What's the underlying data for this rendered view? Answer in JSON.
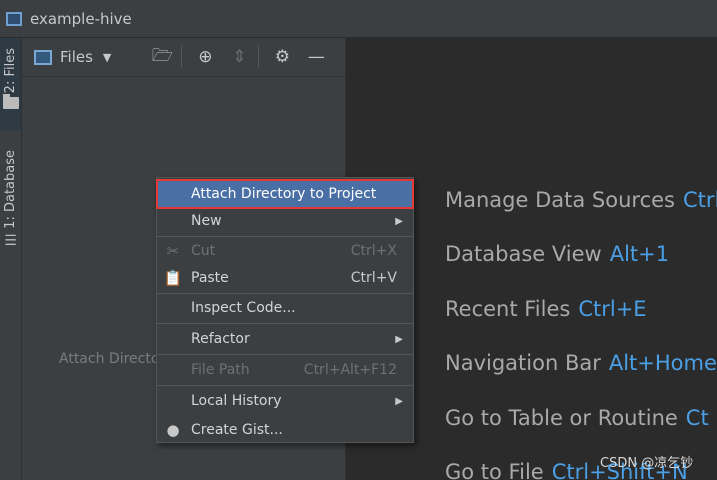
{
  "window": {
    "title": "example-hive"
  },
  "left_strip": {
    "tabs": [
      {
        "label": "2: Files"
      },
      {
        "label": "1: Database"
      }
    ]
  },
  "files_panel": {
    "title": "Files",
    "hint": "Attach Directo"
  },
  "context_menu": {
    "items": [
      {
        "label": "Attach Directory to Project",
        "shortcut": "",
        "selected": true
      },
      {
        "label": "New",
        "shortcut": "",
        "submenu": true
      },
      {
        "label": "Cut",
        "shortcut": "Ctrl+X",
        "icon": "scissors-icon",
        "disabled": true
      },
      {
        "label": "Paste",
        "shortcut": "Ctrl+V",
        "icon": "clipboard-icon"
      },
      {
        "label": "Inspect Code...",
        "shortcut": ""
      },
      {
        "label": "Refactor",
        "shortcut": "",
        "submenu": true
      },
      {
        "label": "File Path",
        "shortcut": "Ctrl+Alt+F12",
        "disabled": true
      },
      {
        "label": "Local History",
        "shortcut": "",
        "submenu": true
      },
      {
        "label": "Create Gist...",
        "shortcut": "",
        "icon": "github-icon"
      }
    ]
  },
  "editor_shortcuts": [
    {
      "action": "Manage Data Sources",
      "keys": "Ctrl"
    },
    {
      "action": "Database View",
      "keys": "Alt+1"
    },
    {
      "action": "Recent Files",
      "keys": "Ctrl+E"
    },
    {
      "action": "Navigation Bar",
      "keys": "Alt+Home"
    },
    {
      "action": "Go to Table or Routine",
      "keys": "Ct"
    },
    {
      "action": "Go to File",
      "keys": "Ctrl+Shift+N"
    }
  ],
  "watermark": "CSDN @凉乞钞",
  "colors": {
    "accent": "#4a9fe6",
    "selection": "#4a6fa5",
    "highlight_border": "#e53935"
  }
}
